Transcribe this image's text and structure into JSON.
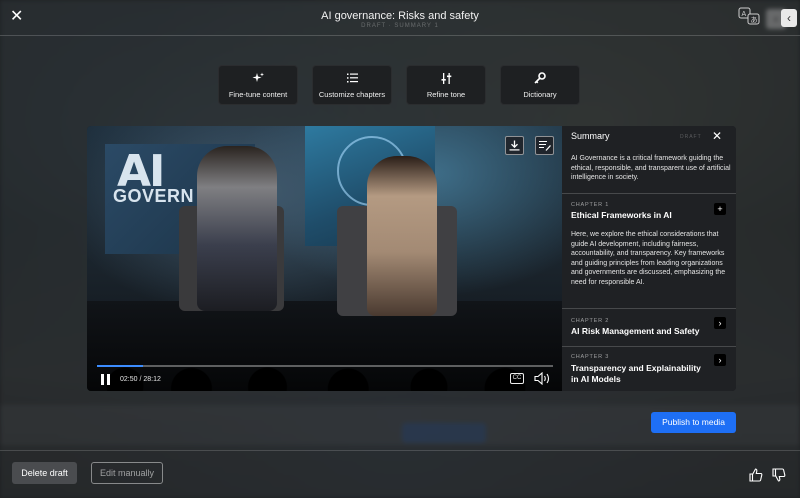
{
  "header": {
    "title": "AI governance: Risks and safety",
    "subtitle": "DRAFT · SUMMARY 1"
  },
  "toolbar": [
    {
      "label": "Fine-tune content",
      "icon": "sparkle-icon"
    },
    {
      "label": "Customize chapters",
      "icon": "list-icon"
    },
    {
      "label": "Refine tone",
      "icon": "sliders-icon"
    },
    {
      "label": "Dictionary",
      "icon": "key-icon"
    }
  ],
  "video": {
    "slide_text_1": "AI",
    "slide_text_2": "GOVERN",
    "timecode": "02:50 / 28:12",
    "progress": 0.1,
    "cc_label": "CC"
  },
  "panel": {
    "heading": "Summary",
    "status": "DRAFT",
    "intro": "AI Governance is a critical framework guiding the ethical, responsible, and transparent use of artificial intelligence in society.",
    "chapters": [
      {
        "label": "CHAPTER 1",
        "title": "Ethical Frameworks in AI",
        "toggle": "+",
        "body": "Here, we explore the ethical considerations that guide AI development, including fairness, accountability, and transparency. Key frameworks and guiding principles from leading organizations and governments are discussed, emphasizing the need for responsible AI."
      },
      {
        "label": "CHAPTER 2",
        "title": "AI Risk Management and Safety",
        "toggle": "›"
      },
      {
        "label": "CHAPTER 3",
        "title": "Transparency and Explainability in AI Models",
        "toggle": "›"
      }
    ]
  },
  "actions": {
    "publish": "Publish to media",
    "delete": "Delete draft",
    "edit": "Edit manually"
  },
  "colors": {
    "accent": "#1e6ff5",
    "progress": "#3c8cff"
  }
}
